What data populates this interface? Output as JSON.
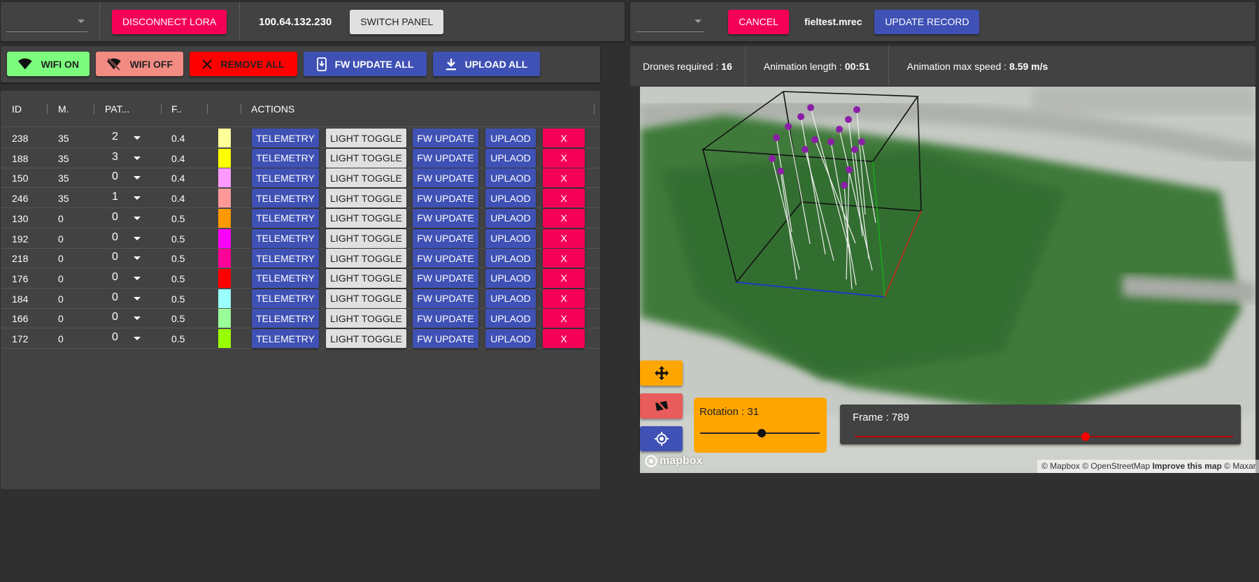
{
  "top_left": {
    "disconnect_label": "DISCONNECT LORA",
    "ip": "100.64.132.230",
    "switch_label": "SWITCH PANEL"
  },
  "top_right": {
    "cancel_label": "CANCEL",
    "filename": "fieltest.mrec",
    "update_label": "UPDATE RECORD"
  },
  "actions": {
    "wifi_on": "WIFI ON",
    "wifi_off": "WIFI OFF",
    "remove_all": "REMOVE ALL",
    "fw_update_all": "FW UPDATE ALL",
    "upload_all": "UPLOAD ALL"
  },
  "table": {
    "headers": [
      "ID",
      "M.",
      "PAT...",
      "F..",
      "",
      "ACTIONS"
    ],
    "row_buttons": {
      "telemetry": "TELEMETRY",
      "light": "LIGHT TOGGLE",
      "fw": "FW UPDATE",
      "upload": "UPLAOD",
      "remove": "X"
    },
    "rows": [
      {
        "id": "238",
        "m": "35",
        "pat": "2",
        "f": "0.4",
        "color": "#ffff99"
      },
      {
        "id": "188",
        "m": "35",
        "pat": "3",
        "f": "0.4",
        "color": "#ffff00"
      },
      {
        "id": "150",
        "m": "35",
        "pat": "0",
        "f": "0.4",
        "color": "#ff99ff"
      },
      {
        "id": "246",
        "m": "35",
        "pat": "1",
        "f": "0.4",
        "color": "#ff9999"
      },
      {
        "id": "130",
        "m": "0",
        "pat": "0",
        "f": "0.5",
        "color": "#ff9900"
      },
      {
        "id": "192",
        "m": "0",
        "pat": "0",
        "f": "0.5",
        "color": "#ff00ff"
      },
      {
        "id": "218",
        "m": "0",
        "pat": "0",
        "f": "0.5",
        "color": "#ff0099"
      },
      {
        "id": "176",
        "m": "0",
        "pat": "0",
        "f": "0.5",
        "color": "#ff0000"
      },
      {
        "id": "184",
        "m": "0",
        "pat": "0",
        "f": "0.5",
        "color": "#99ffff"
      },
      {
        "id": "166",
        "m": "0",
        "pat": "0",
        "f": "0.5",
        "color": "#99ff99"
      },
      {
        "id": "172",
        "m": "0",
        "pat": "0",
        "f": "0.5",
        "color": "#99ff00"
      }
    ]
  },
  "info": {
    "drones_label": "Drones required :",
    "drones_value": "16",
    "length_label": "Animation length :",
    "length_value": "00:51",
    "speed_label": "Animation max speed :",
    "speed_value": "8.59 m/s"
  },
  "map": {
    "rotation_label": "Rotation : 31",
    "rotation_value": 31,
    "frame_label": "Frame : 789",
    "frame_progress": 0.61,
    "mapbox_logo": "mapbox",
    "attrib_mapbox": "© Mapbox",
    "attrib_osm": "© OpenStreetMap",
    "attrib_improve": "Improve this map",
    "attrib_maxar": "© Maxar"
  },
  "icons": [
    "wifi-icon",
    "wifi-off-icon",
    "close-icon",
    "system-update-icon",
    "download-icon",
    "pan-icon",
    "visibility-off-icon",
    "my-location-icon"
  ],
  "colors": {
    "pink": "#f50057",
    "indigo": "#3f51b5",
    "orange": "#ffa500",
    "red": "#ff0000"
  }
}
